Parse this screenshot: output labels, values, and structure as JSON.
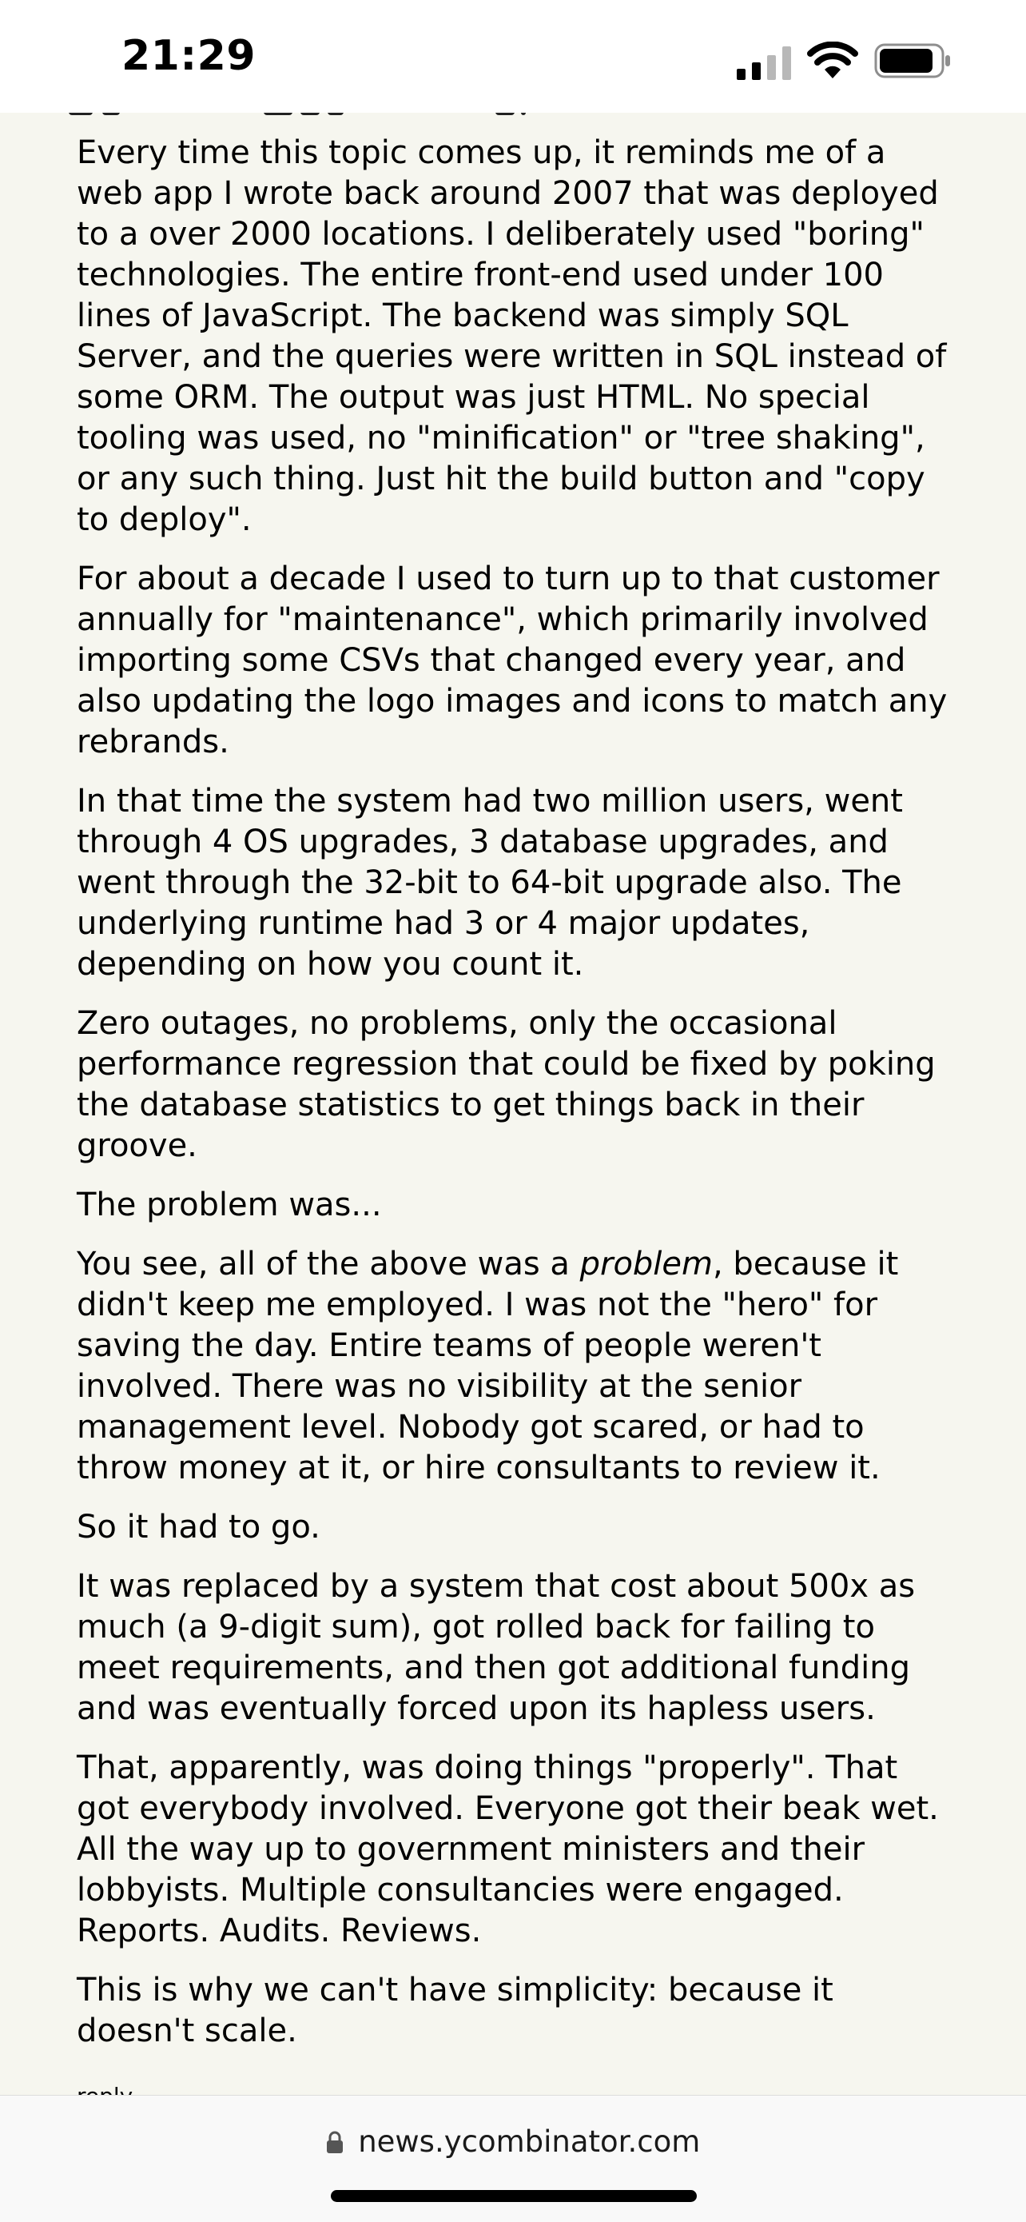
{
  "status_bar": {
    "time": "21:29"
  },
  "comment": {
    "paragraphs": [
      "Every time this topic comes up, it reminds me of a web app I wrote back around 2007 that was deployed to a over 2000 locations. I deliberately used \"boring\" technologies. The entire front-end used under 100 lines of JavaScript. The backend was simply SQL Server, and the queries were written in SQL instead of some ORM. The output was just HTML. No special tooling was used, no \"minification\" or \"tree shaking\", or any such thing. Just hit the build button and \"copy to deploy\".",
      "For about a decade I used to turn up to that customer annually for \"maintenance\", which primarily involved importing some CSVs that changed every year, and also updating the logo images and icons to match any rebrands.",
      "In that time the system had two million users, went through 4 OS upgrades, 3 database upgrades, and went through the 32-bit to 64-bit upgrade also. The underlying runtime had 3 or 4 major updates, depending on how you count it.",
      "Zero outages, no problems, only the occasional performance regression that could be fixed by poking the database statistics to get things back in their groove.",
      "The problem was..."
    ],
    "problem_paragraph": {
      "before": "You see, all of the above was a ",
      "emphasis": "problem",
      "after": ", because it didn't keep me employed. I was not the \"hero\" for saving the day. Entire teams of people weren't involved. There was no visibility at the senior management level. Nobody got scared, or had to throw money at it, or hire consultants to review it."
    },
    "paragraphs_after": [
      "So it had to go.",
      "It was replaced by a system that cost about 500x as much (a 9-digit sum), got rolled back for failing to meet requirements, and then got additional funding and was eventually forced upon its hapless users.",
      "That, apparently, was doing things \"properly\". That got everybody involved. Everyone got their beak wet. All the way up to government ministers and their lobbyists. Multiple consultancies were engaged. Reports. Audits. Reviews.",
      "This is why we can't have simplicity: because it doesn't scale."
    ],
    "reply_label": "reply"
  },
  "browser": {
    "url": "news.ycombinator.com",
    "lock_icon": "lock-icon"
  }
}
